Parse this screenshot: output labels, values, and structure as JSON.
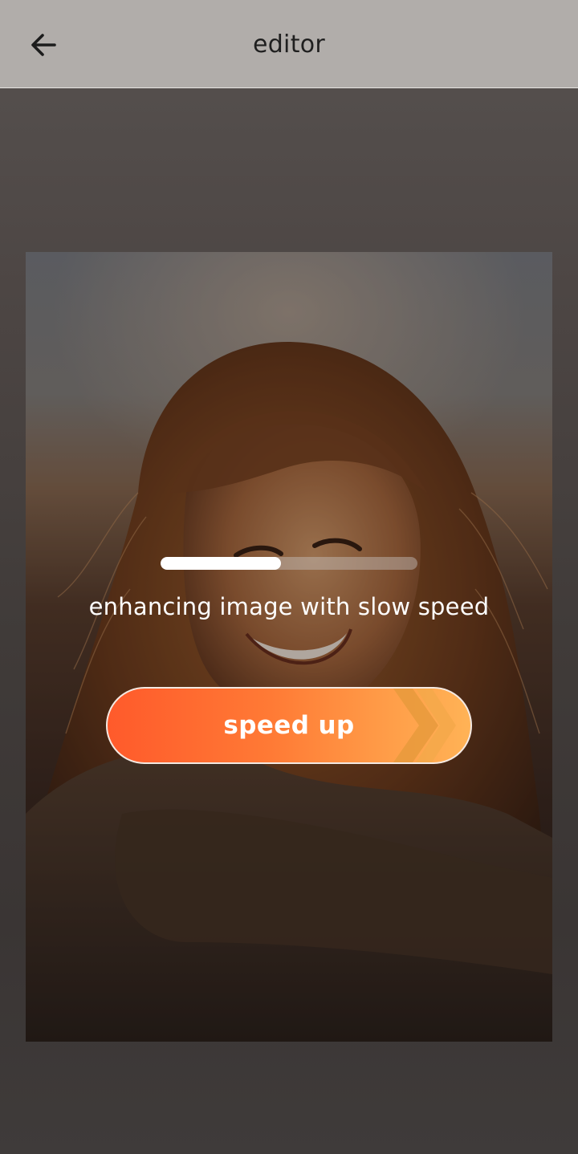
{
  "header": {
    "title": "editor",
    "back_icon": "arrow-left-icon"
  },
  "overlay": {
    "progress": 0.47,
    "status_text": "enhancing image with slow speed",
    "button_label": "speed up",
    "button_icon": "double-chevron-right-icon"
  },
  "colors": {
    "app_bar": "#b1adaa",
    "button_start": "#ff5a2b",
    "button_end": "#ffb356",
    "progress_fill": "#ffffff"
  }
}
